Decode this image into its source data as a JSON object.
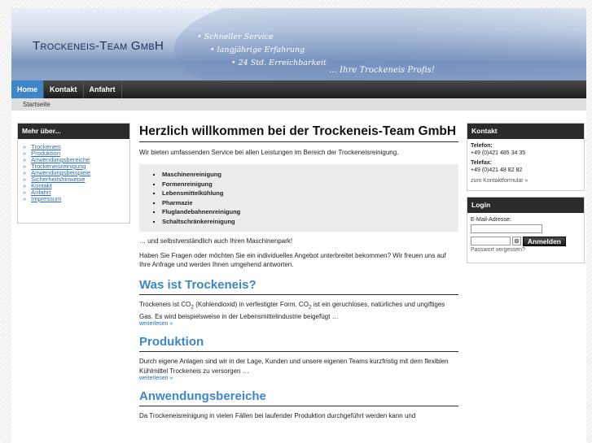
{
  "header": {
    "logo": "Trockeneis-Team GmbH",
    "bullets": [
      "• Schneller Service",
      "• langjährige Erfahrung",
      "• 24 Std. Erreichbarkeit"
    ],
    "tagline": "… Ihre Trockeneis Profis!"
  },
  "nav": {
    "items": [
      {
        "label": "Home",
        "active": true
      },
      {
        "label": "Kontakt",
        "active": false
      },
      {
        "label": "Anfahrt",
        "active": false
      }
    ],
    "breadcrumb": "Startseite"
  },
  "left_sidebar": {
    "title": "Mehr über...",
    "links": [
      "Trockeneis",
      "Produktion",
      "Anwendungsbereiche",
      "Trockeneisreinigung",
      "Anwendungsbeispiele",
      "Sicherheitshinweise",
      "Kontakt",
      "Anfahrt",
      "Impressum"
    ]
  },
  "main": {
    "title": "Herzlich willkommen bei der Trockeneis-Team GmbH",
    "intro": "Wir bieten umfassenden Service bei allen Leistungen im Bereich der Trockeneisreinigung.",
    "services": [
      "Maschinenreinigung",
      "Formenreinigung",
      "Lebensmittelkühlung",
      "Pharmazie",
      "Fluglandebahnenreinigung",
      "Schaltschränkereinigung"
    ],
    "after_list": "… und selbstverständlich auch Ihren Maschinenpark!",
    "contact_para": "Haben Sie Fragen oder möchten Sie ein individuelles Angebot unterbreitet bekommen? Wir freuen uns auf Ihre Anfrage und werden Ihnen umgehend antworten.",
    "sections": [
      {
        "heading": "Was ist Trockeneis?",
        "text_a": "Trockeneis ist CO",
        "sub_a": "2",
        "text_b": " (Kohlendioxid) in verfestigter Form. CO",
        "sub_b": "2",
        "text_c": " ist ein geruchloses, natürliches und ungiftiges Gas. Es wird beispielsweise in der Lebensmittelindustrie beigefügt …",
        "more": "weiterlesen »"
      },
      {
        "heading": "Produktion",
        "text": "Durch eigene Anlagen sind wir in der Lage, Kunden und unsere eigenen Teams kurzfristig mit dem flexiblen Kühlmittel Trockeneis zu versorgen …",
        "more": "weiterlesen »"
      },
      {
        "heading": "Anwendungsbereiche",
        "text": "Da Trockeneisreinigung in vielen Fällen bei laufender Produktion durchgeführt werden kann und"
      }
    ]
  },
  "contact_box": {
    "title": "Kontakt",
    "phone_label": "Telefon:",
    "phone": "+49 (0)421 485 34 35",
    "fax_label": "Telefax:",
    "fax": "+49 (0)421 48 82 82",
    "form_link": "zum Kontaktformular »"
  },
  "login_box": {
    "title": "Login",
    "email_label": "E-Mail-Adresse:",
    "button": "Anmelden",
    "toggle_icon": "⊚",
    "forgot": "Passwort vergessen?"
  },
  "colors": {
    "accent": "#3c86c9",
    "nav_bg": "#1c1c1c",
    "heading": "#3c86c9"
  }
}
